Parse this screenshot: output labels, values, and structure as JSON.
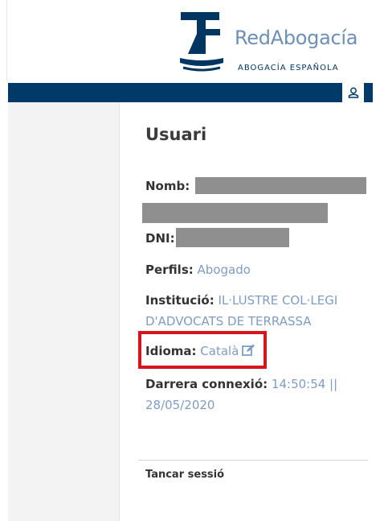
{
  "brand": {
    "name": "RedAbogacía",
    "subtitle": "ABOGACÍA ESPAÑOLA"
  },
  "header": {
    "user_icon": "user-icon"
  },
  "profile": {
    "title": "Usuari",
    "name_label": "Nomb:",
    "dni_label": "DNI:",
    "profiles_label": "Perfils:",
    "profiles_value": "Abogado",
    "institution_label": "Institució:",
    "institution_value_line1": "IL·LUSTRE COL·LEGI",
    "institution_value_line2": "D'ADVOCATS DE TERRASSA",
    "language_label": "Idioma:",
    "language_value": "Català",
    "language_edit_icon": "edit-icon",
    "last_connection_label": "Darrera connexió:",
    "last_connection_value_line1": "14:50:54 ||",
    "last_connection_value_line2": "28/05/2020"
  },
  "footer": {
    "logout_label": "Tancar sessió"
  },
  "colors": {
    "navy": "#003a68",
    "link": "#7f9cc1",
    "highlight": "#d8141c"
  }
}
